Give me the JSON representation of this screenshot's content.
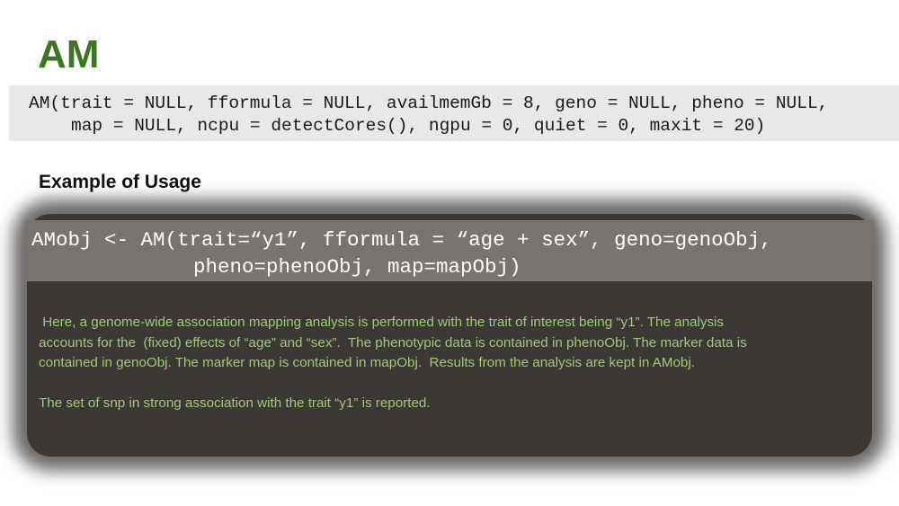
{
  "title": "AM",
  "signature": {
    "lines": [
      "AM(trait = NULL, fformula = NULL, availmemGb = 8, geno = NULL, pheno = NULL,",
      "map = NULL, ncpu = detectCores(), ngpu = 0, quiet = 0, maxit = 20)"
    ]
  },
  "example_heading": "Example of Usage",
  "example": {
    "code_lines": [
      "AMobj <- AM(trait=“y1”, fformula = “age + sex”, geno=genoObj,",
      "pheno=phenoObj, map=mapObj)"
    ],
    "description_lines": [
      " Here, a genome-wide association mapping analysis is performed with the trait of interest being “y1”. The analysis",
      "accounts for the  (fixed) effects of “age” and “sex”.  The phenotypic data is contained in phenoObj. The marker data is",
      "contained in genoObj. The marker map is contained in mapObj.  Results from the analysis are kept in AMobj."
    ],
    "note": "The set of snp in strong association with the trait “y1” is reported."
  },
  "colors": {
    "title": "#3e7523",
    "signature_background": "#e8e8e8",
    "panel_background": "#3b3836",
    "code_background": "#787471",
    "description_text": "#a2c77c"
  }
}
